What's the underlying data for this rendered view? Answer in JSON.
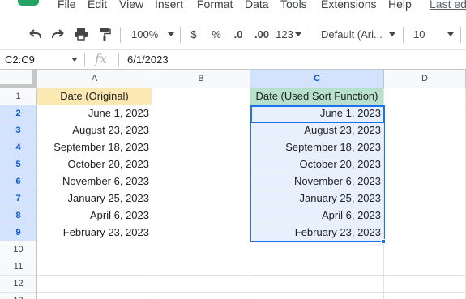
{
  "menu": {
    "items": [
      "File",
      "Edit",
      "View",
      "Insert",
      "Format",
      "Data",
      "Tools",
      "Extensions",
      "Help"
    ],
    "last_edit": "Last ed"
  },
  "toolbar": {
    "zoom": "100%",
    "currency": "$",
    "percent": "%",
    "decrease_decimal": ".0",
    "increase_decimal": ".00",
    "more_formats": "123",
    "font": "Default (Ari...",
    "font_size": "10",
    "icons": [
      "undo-icon",
      "redo-icon",
      "print-icon",
      "paint-format-icon"
    ]
  },
  "formula_bar": {
    "name_box": "C2:C9",
    "fx": "fx",
    "formula": "6/1/2023"
  },
  "sheet": {
    "columns": [
      "A",
      "B",
      "C",
      "D"
    ],
    "rows": [
      "1",
      "2",
      "3",
      "4",
      "5",
      "6",
      "7",
      "8",
      "9",
      "10",
      "11",
      "12",
      "13"
    ],
    "header_a": "Date (Original)",
    "header_c": "Date (Used Sort Function)",
    "col_a": [
      "June 1, 2023",
      "August 23, 2023",
      "September 18, 2023",
      "October 20, 2023",
      "November 6, 2023",
      "January 25, 2023",
      "April 6, 2023",
      "February 23, 2023"
    ],
    "col_c": [
      "June 1, 2023",
      "August 23, 2023",
      "September 18, 2023",
      "October 20, 2023",
      "November 6, 2023",
      "January 25, 2023",
      "April 6, 2023",
      "February 23, 2023"
    ],
    "selected_columns": [
      "C"
    ],
    "selected_rows": [
      "2",
      "3",
      "4",
      "5",
      "6",
      "7",
      "8",
      "9"
    ]
  },
  "colors": {
    "header_a_fill": "#fce8b2",
    "header_c_fill": "#b7e1cd",
    "selection": "#1a73e8",
    "selection_fill": "#e8f0fe"
  }
}
